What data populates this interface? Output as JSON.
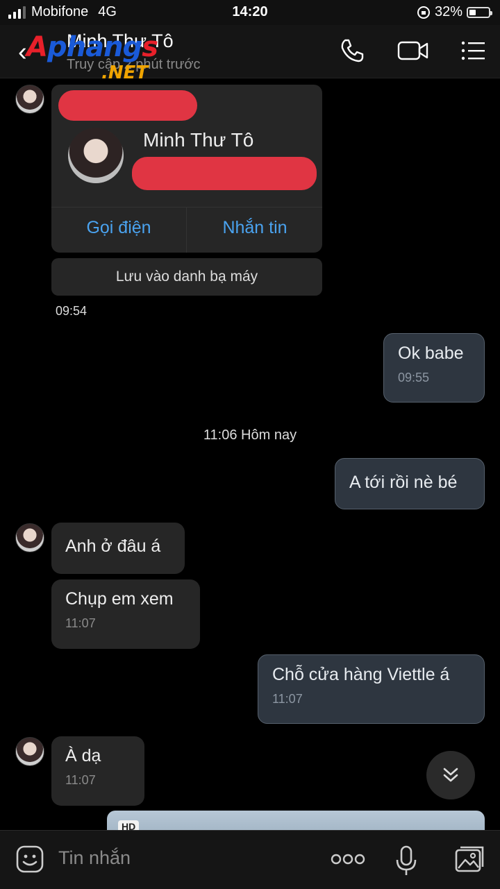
{
  "status_bar": {
    "carrier": "Mobifone",
    "network": "4G",
    "time": "14:20",
    "battery_percent": "32%",
    "battery_level": 0.32
  },
  "header": {
    "back_icon": "chevron-left-icon",
    "title": "Minh Thư Tô",
    "subtitle": "Truy cập 2 phút trước",
    "watermark_main": "Aphangs",
    "watermark_net": ".NET",
    "icons": [
      "phone-icon",
      "video-call-icon",
      "menu-list-icon"
    ]
  },
  "contact_card": {
    "name": "Minh Thư Tô",
    "call_label": "Gọi điện",
    "message_label": "Nhắn tin",
    "save_label": "Lưu vào danh bạ máy",
    "time": "09:54"
  },
  "messages": [
    {
      "side": "out",
      "text": "Ok babe",
      "time": "09:55"
    },
    {
      "side": "divider",
      "text": "11:06 Hôm nay"
    },
    {
      "side": "out",
      "text": "A tới rồi nè bé",
      "time": ""
    },
    {
      "side": "in",
      "text": "Anh ở đâu á",
      "time": ""
    },
    {
      "side": "in",
      "text": "Chụp em xem",
      "time": "11:07"
    },
    {
      "side": "out",
      "text": "Chỗ cửa hàng Viettle á",
      "time": "11:07"
    },
    {
      "side": "in",
      "text": "À dạ",
      "time": "11:07"
    }
  ],
  "media_preview": {
    "badge": "HD"
  },
  "composer": {
    "placeholder": "Tin nhắn",
    "icons": [
      "sticker-icon",
      "more-icon",
      "microphone-icon",
      "image-icon"
    ]
  },
  "colors": {
    "background": "#000000",
    "bubble_in": "#262626",
    "bubble_out": "#2e3640",
    "link_blue": "#4aa3f0",
    "redaction": "#e03543"
  }
}
